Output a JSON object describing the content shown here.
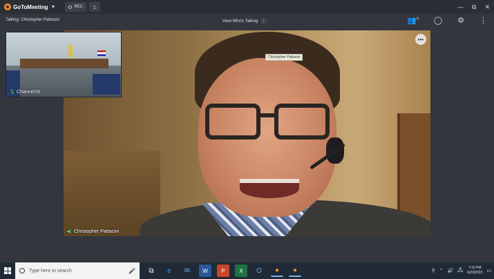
{
  "titlebar": {
    "app_name": "GoToMeeting",
    "rec_label": "REC",
    "controls": [
      "—",
      "⧉",
      "✕"
    ]
  },
  "infobar": {
    "talking": "Talking: Christopher Pattacini",
    "view_whos_talking": "View Who's Talking",
    "attendee_count": "9"
  },
  "main_video": {
    "participant_name": "Christopher Pattacini",
    "hover_tooltip": "Christopher Pattacini",
    "more_label": "•••"
  },
  "thumbnail": {
    "participant_name": "Channel16"
  },
  "taskbar": {
    "search_placeholder": "Type here to search",
    "time": "7:10 PM",
    "date": "6/23/2022"
  },
  "colors": {
    "brand_orange": "#f68d2e",
    "talking_green": "#5fd07a",
    "background": "#33363d"
  }
}
